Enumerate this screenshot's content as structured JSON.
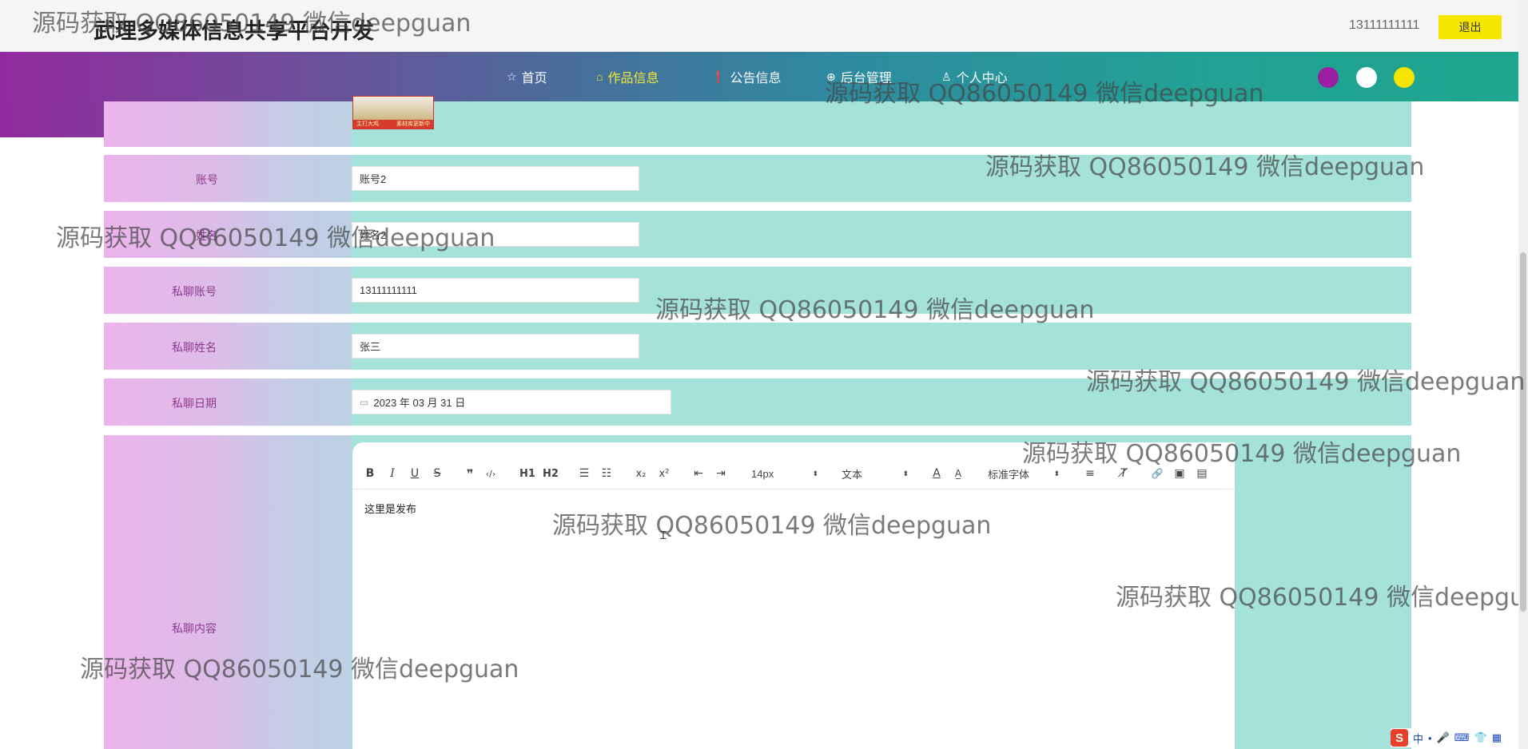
{
  "header": {
    "site_title": "武理多媒体信息共享平台开发",
    "user_phone": "13111111111",
    "logout_label": "退出"
  },
  "nav": {
    "items": [
      {
        "icon": "☆",
        "label": "首页"
      },
      {
        "icon": "⌂",
        "label": "作品信息"
      },
      {
        "icon": "❗",
        "label": "公告信息"
      },
      {
        "icon": "⊕",
        "label": "后台管理"
      },
      {
        "icon": "♙",
        "label": "个人中心"
      }
    ],
    "active_index": 1,
    "theme_colors": [
      "#9b1fa3",
      "#ffffff",
      "#f4e400"
    ]
  },
  "image_preview": {
    "caption_left": "主打大鸡",
    "caption_right": "素材库更新中"
  },
  "form": {
    "account": {
      "label": "账号",
      "value": "账号2"
    },
    "name": {
      "label": "姓名",
      "value": "姓名2"
    },
    "chat_account": {
      "label": "私聊账号",
      "value": "13111111111"
    },
    "chat_name": {
      "label": "私聊姓名",
      "value": "张三"
    },
    "chat_date": {
      "label": "私聊日期",
      "value": "2023 年 03 月 31 日"
    },
    "chat_content": {
      "label": "私聊内容",
      "value": "这里是发布"
    }
  },
  "editor": {
    "toolbar": {
      "bold": "B",
      "italic": "I",
      "underline": "U",
      "strike": "S",
      "blockquote": "❞",
      "code": "‹/›",
      "h1": "H1",
      "h2": "H2",
      "ordered_list": "☰",
      "bullet_list": "☷",
      "subscript": "x₂",
      "superscript": "x²",
      "outdent": "⇤",
      "indent": "⇥",
      "font_size": "14px",
      "header_select": "文本",
      "font_family": "标准字体",
      "color": "A",
      "background": "A̲",
      "align": "≡",
      "clean": "T̸",
      "link": "🔗",
      "image": "▣",
      "video": "▤"
    }
  },
  "watermark_text": "源码获取 QQ86050149 微信deepguan",
  "ime": {
    "logo": "S",
    "mode": "中",
    "items": [
      "•",
      "🎤",
      "⌨",
      "👕",
      "▦"
    ]
  }
}
